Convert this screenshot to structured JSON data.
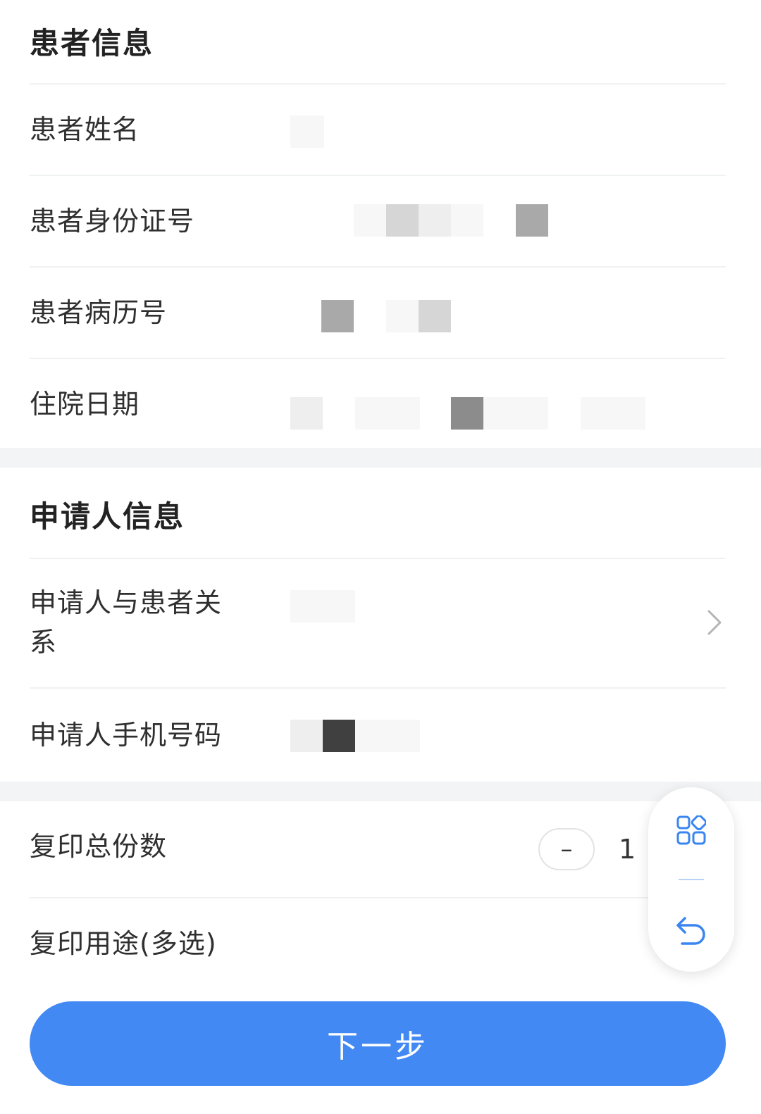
{
  "patient_info": {
    "title": "患者信息",
    "name_label": "患者姓名",
    "id_label": "患者身份证号",
    "record_label": "患者病历号",
    "date_label": "住院日期"
  },
  "applicant_info": {
    "title": "申请人信息",
    "relation_label_line1": "申请人与患者关",
    "relation_label_line2": "系",
    "phone_label": "申请人手机号码"
  },
  "copy": {
    "count_label": "复印总份数",
    "minus_symbol": "–",
    "count_value": "1",
    "purpose_label": "复印用途(多选)"
  },
  "next_button": "下一步",
  "float_menu": {
    "top_icon": "apps-grid-icon",
    "bottom_icon": "back-arrow-icon"
  },
  "colors": {
    "primary": "#4289f3",
    "icon_blue": "#3a86f0"
  }
}
